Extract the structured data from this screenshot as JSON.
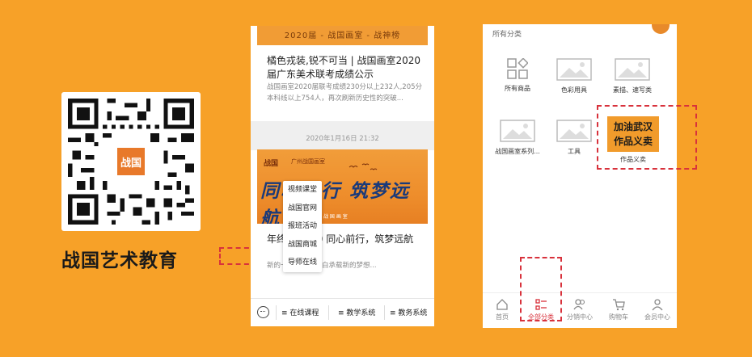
{
  "brand": {
    "qr_logo": "战国",
    "name": "战国艺术教育"
  },
  "phone1": {
    "header": "2020届 - 战国画室 - 战神榜",
    "article1": {
      "title": "橘色戎装,锐不可当 | 战国画室2020届广东美术联考成绩公示",
      "summary": "战国画室2020届联考成绩230分以上232人,205分本科线以上754人，再次刷新历史性的突破..."
    },
    "date": "2020年1月16日 21:32",
    "banner": {
      "logo": "战国",
      "sub_logo": "广州战国画室",
      "calligraphy": "同心前行 筑梦远航",
      "tagline": "战 国 画 室"
    },
    "article2": {
      "title": "年终 ─ 2020 同心前行，筑梦远航",
      "summary": "新的一年，新的空白承载新的梦想..."
    },
    "popup_menu": [
      "视频课堂",
      "战国官网",
      "报班活动",
      "战国商城",
      "导师在线"
    ],
    "tabbar": [
      {
        "label": "在线课程",
        "icon": "menu-icon"
      },
      {
        "label": "教学系统",
        "icon": "menu-icon"
      },
      {
        "label": "教务系统",
        "icon": "menu-icon"
      }
    ],
    "keyboard_icon": "keyboard-icon"
  },
  "phone2": {
    "header": "所有分类",
    "categories": [
      {
        "label": "所有商品",
        "icon": "grid-icon"
      },
      {
        "label": "色彩用具",
        "icon": "image-icon"
      },
      {
        "label": "素描、速写类",
        "icon": "image-icon"
      },
      {
        "label": "战国画室系列...",
        "icon": "image-icon"
      },
      {
        "label": "工具",
        "icon": "image-icon"
      }
    ],
    "special": {
      "line1": "加油武汉",
      "line2": "作品义卖",
      "label": "作品义卖"
    },
    "tabbar": [
      {
        "label": "首页",
        "icon": "home-icon"
      },
      {
        "label": "全部分类",
        "icon": "list-icon",
        "active": true
      },
      {
        "label": "分销中心",
        "icon": "users-icon"
      },
      {
        "label": "购物车",
        "icon": "cart-icon"
      },
      {
        "label": "会员中心",
        "icon": "member-icon"
      }
    ]
  },
  "colors": {
    "background": "#F7A128",
    "accent_red": "#D8323C",
    "banner_orange": "#EE8E2C"
  }
}
